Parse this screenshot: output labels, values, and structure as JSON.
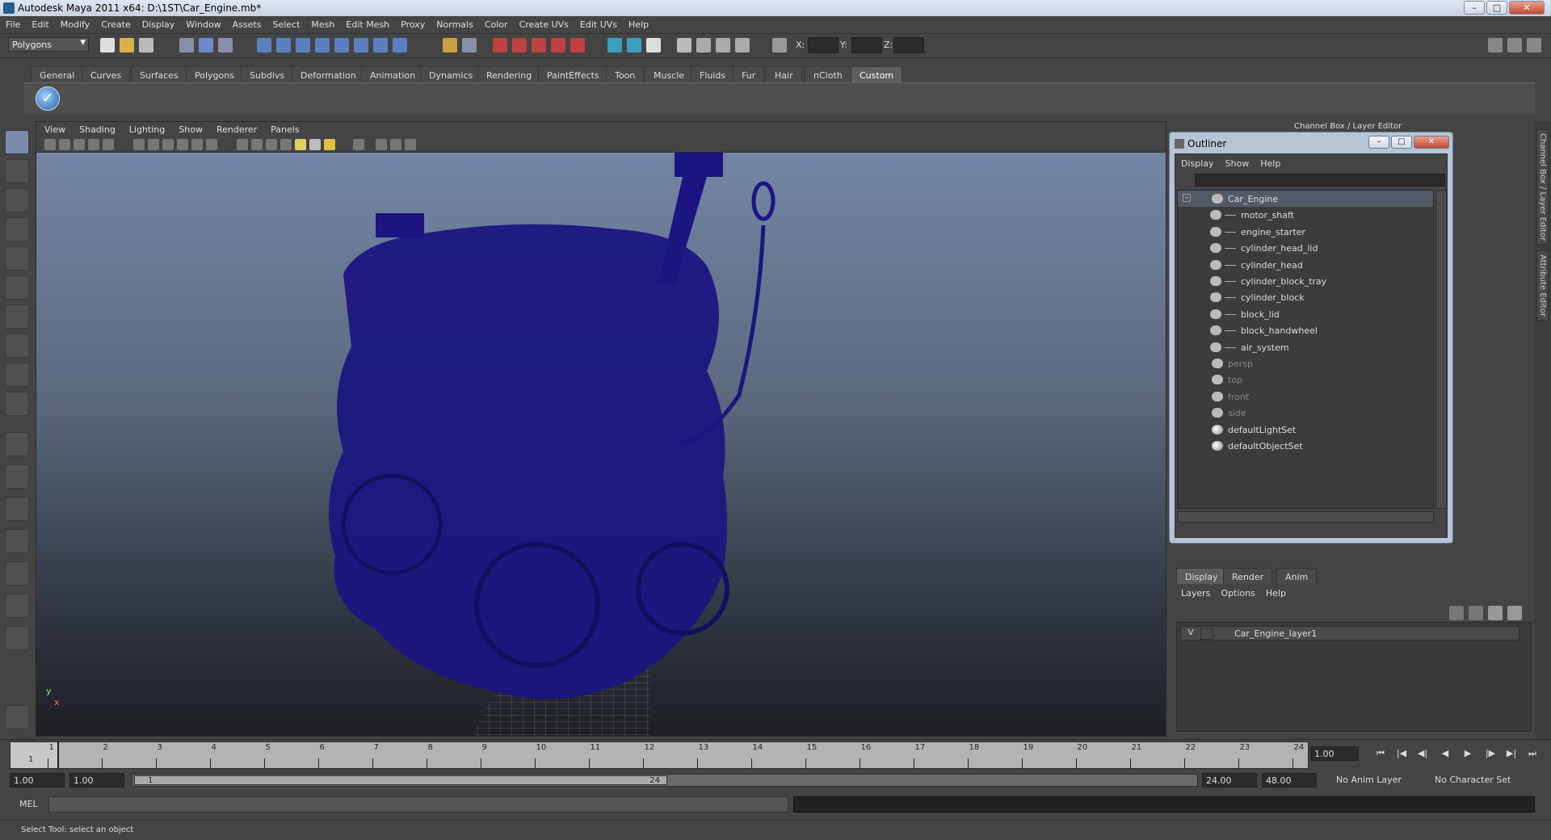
{
  "window": {
    "title": "Autodesk Maya 2011 x64: D:\\1ST\\Car_Engine.mb*"
  },
  "menu": [
    "File",
    "Edit",
    "Modify",
    "Create",
    "Display",
    "Window",
    "Assets",
    "Select",
    "Mesh",
    "Edit Mesh",
    "Proxy",
    "Normals",
    "Color",
    "Create UVs",
    "Edit UVs",
    "Help"
  ],
  "status": {
    "mode": "Polygons",
    "x_label": "X:",
    "y_label": "Y:",
    "z_label": "Z:"
  },
  "shelf_tabs": [
    "General",
    "Curves",
    "Surfaces",
    "Polygons",
    "Subdivs",
    "Deformation",
    "Animation",
    "Dynamics",
    "Rendering",
    "PaintEffects",
    "Toon",
    "Muscle",
    "Fluids",
    "Fur",
    "Hair",
    "nCloth",
    "Custom"
  ],
  "shelf_active": "Custom",
  "viewport": {
    "menu": [
      "View",
      "Shading",
      "Lighting",
      "Show",
      "Renderer",
      "Panels"
    ],
    "axis_y": "y",
    "axis_x": "x"
  },
  "right_panel": {
    "label": "Channel Box / Layer Editor",
    "side_tabs": [
      "Channel Box / Layer Editor",
      "Attribute Editor"
    ]
  },
  "outliner": {
    "title": "Outliner",
    "menu": [
      "Display",
      "Show",
      "Help"
    ],
    "items": [
      {
        "label": "Car_Engine",
        "level": 0,
        "selected": true,
        "dim": false,
        "type": "group"
      },
      {
        "label": "motor_shaft",
        "level": 1,
        "selected": false,
        "dim": false,
        "type": "mesh"
      },
      {
        "label": "engine_starter",
        "level": 1,
        "selected": false,
        "dim": false,
        "type": "mesh"
      },
      {
        "label": "cylinder_head_lid",
        "level": 1,
        "selected": false,
        "dim": false,
        "type": "mesh"
      },
      {
        "label": "cylinder_head",
        "level": 1,
        "selected": false,
        "dim": false,
        "type": "mesh"
      },
      {
        "label": "cylinder_block_tray",
        "level": 1,
        "selected": false,
        "dim": false,
        "type": "mesh"
      },
      {
        "label": "cylinder_block",
        "level": 1,
        "selected": false,
        "dim": false,
        "type": "mesh"
      },
      {
        "label": "block_lid",
        "level": 1,
        "selected": false,
        "dim": false,
        "type": "mesh"
      },
      {
        "label": "block_handwheel",
        "level": 1,
        "selected": false,
        "dim": false,
        "type": "mesh"
      },
      {
        "label": "air_system",
        "level": 1,
        "selected": false,
        "dim": false,
        "type": "mesh"
      },
      {
        "label": "persp",
        "level": 0,
        "selected": false,
        "dim": true,
        "type": "camera"
      },
      {
        "label": "top",
        "level": 0,
        "selected": false,
        "dim": true,
        "type": "camera"
      },
      {
        "label": "front",
        "level": 0,
        "selected": false,
        "dim": true,
        "type": "camera"
      },
      {
        "label": "side",
        "level": 0,
        "selected": false,
        "dim": true,
        "type": "camera"
      },
      {
        "label": "defaultLightSet",
        "level": 0,
        "selected": false,
        "dim": false,
        "type": "set"
      },
      {
        "label": "defaultObjectSet",
        "level": 0,
        "selected": false,
        "dim": false,
        "type": "set"
      }
    ]
  },
  "layer_editor": {
    "tabs": [
      "Display",
      "Render",
      "Anim"
    ],
    "active_tab": "Display",
    "menu": [
      "Layers",
      "Options",
      "Help"
    ],
    "layers": [
      {
        "visible": "V",
        "name": "Car_Engine_layer1"
      }
    ]
  },
  "timeline": {
    "ticks": [
      "1",
      "2",
      "3",
      "4",
      "5",
      "6",
      "7",
      "8",
      "9",
      "10",
      "11",
      "12",
      "13",
      "14",
      "15",
      "16",
      "17",
      "18",
      "19",
      "20",
      "21",
      "22",
      "23",
      "24"
    ],
    "current_frame": "1",
    "current_time": "1.00"
  },
  "range": {
    "start_time": "1.00",
    "playback_start": "1.00",
    "range_start": "1",
    "range_end": "24",
    "playback_end": "24.00",
    "end_time": "48.00",
    "anim_layer": "No Anim Layer",
    "character_set": "No Character Set"
  },
  "command_line": {
    "label": "MEL"
  },
  "help_line": {
    "text": "Select Tool: select an object"
  },
  "colors": {
    "wireframe": "#1a1580",
    "viewport_top": "#7386a5",
    "viewport_bottom": "#1d1f24"
  }
}
